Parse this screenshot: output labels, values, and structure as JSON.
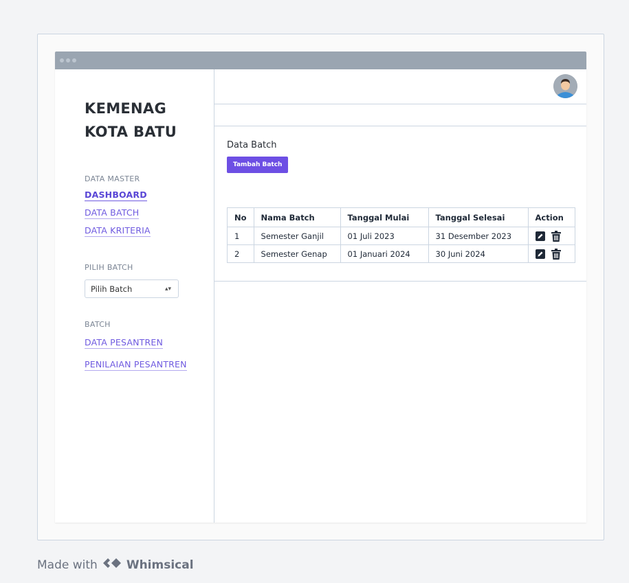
{
  "sidebar": {
    "brand_line1": "KEMENAG",
    "brand_line2": "KOTA BATU",
    "section_master": "DATA MASTER",
    "nav_dashboard": "DASHBOARD",
    "nav_data_batch": "DATA BATCH",
    "nav_data_kriteria": "DATA KRITERIA",
    "section_pilih": "PILIH BATCH",
    "select_value": "Pilih Batch",
    "section_batch": "BATCH",
    "nav_data_pesantren": "DATA PESANTREN",
    "nav_penilaian": "PENILAIAN PESANTREN"
  },
  "main": {
    "title": "Data Batch",
    "add_button": "Tambah Batch",
    "table": {
      "headers": [
        "No",
        "Nama Batch",
        "Tanggal Mulai",
        "Tanggal Selesai",
        "Action"
      ],
      "rows": [
        [
          "1",
          "Semester Ganjil",
          "01 Juli 2023",
          "31 Desember 2023"
        ],
        [
          "2",
          "Semester Genap",
          "01 Januari 2024",
          "30 Juni 2024"
        ]
      ]
    }
  },
  "footer": {
    "made_with": "Made with",
    "brand": "Whimsical"
  },
  "colors": {
    "accent": "#6d4fe4",
    "link": "#6f5ae0",
    "titlebar": "#9aa5b1"
  }
}
